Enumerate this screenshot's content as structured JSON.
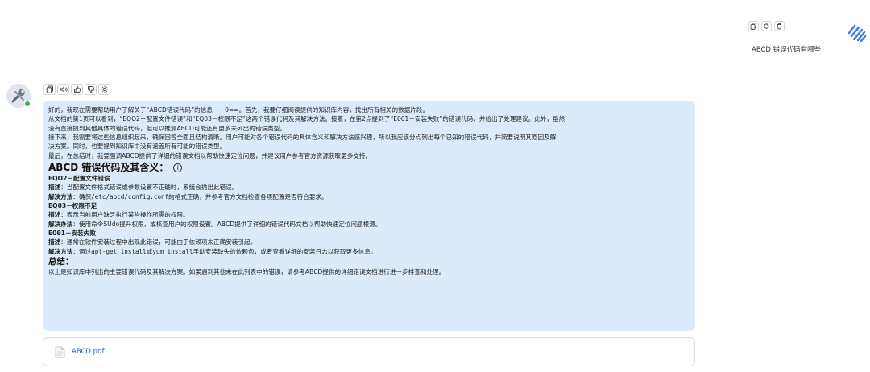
{
  "user_message": {
    "text": "ABCD 错误代码有哪些",
    "actions": [
      "copy-icon",
      "refresh-icon",
      "trash-icon"
    ]
  },
  "assistant": {
    "actions": [
      "copy-icon",
      "speaker-icon",
      "thumbs-up-icon",
      "thumbs-down-icon",
      "sparkle-icon"
    ],
    "reasoning": [
      "好的，我现在需要帮助用户了解关于“ABCD错误代码”的信息 ~~0==。首先，我要仔细阅读提供的知识库内容，找出所有相关的数据片段。",
      "从文档的第1页可以看到，“EQO2－配置文件错误”和“EQ03－权限不足”这两个错误代码及其解决方法。接着，在第2点提到了“E0θ1－安装失败”的错误代码，并给出了处理建议。此外，虽然",
      "没有直接提到其他具体的错误代码，但可以推测ABCD可能还有更多未列出的错误类型。",
      "接下来，我需要将这些信息组织起来，确保回答全面且结构清晰。用户可能对各个错误代码的具体含义和解决方法感兴趣，所以我应该分点列出每个已知的错误代码，并简要说明其原因及解",
      "决方案。同时，也要提到知识库中没有涵盖所有可能的错误类型。",
      "最后，在总结时，我要强调ABCD提供了详细的错误文档以帮助快速定位问题，并建议用户参考官方资源获取更多支持。"
    ],
    "heading": "ABCD 错误代码及其含义：",
    "heading_icon": "ⓘ",
    "errors": [
      {
        "code": "EQO2－配置文件错误",
        "desc_label": "描述",
        "desc": "当配置文件格式错误或参数设置不正确时，系统会抛出此错误。",
        "fix_label": "解决方法",
        "fix_pre": "确保",
        "fix_code": "/etc/abcd/config.conf",
        "fix_post": "的格式正确，并参考官方文档检查各项配置是否符合要求。"
      },
      {
        "code": "EQ03－权限不足",
        "desc_label": "描述",
        "desc": "表示当前用户缺乏执行某些操作所需的权限。",
        "fix_label": "解决办法",
        "fix_pre": "使用命令SUdo提升权限，或核查用户的权限设置。ABCD提供了详细的错误代码文档以帮助快速定位问题根源。",
        "fix_code": "",
        "fix_post": ""
      },
      {
        "code": "E0θ1－安装失败",
        "desc_label": "描述",
        "desc": "通常在软件安装过程中出现此错误，可能由于依赖项未正确安装引起。",
        "fix_label": "解决方法",
        "fix_pre": "通过",
        "fix_code": "apt-get install",
        "fix_mid": "或",
        "fix_code2": "yum install",
        "fix_post": "手动安装缺失的依赖包，或者查看详细的安装日志以获取更多信息。"
      }
    ],
    "summary_heading": "总结：",
    "summary": "以上是知识库中列出的主要错误代码及其解决方案。如果遇到其他未在此列表中的错误，请参考ABCD提供的详细错误文档进行进一步排查和处理。",
    "attachment": {
      "name": "ABCD.pdf",
      "icon": "pdf-file-icon"
    }
  }
}
